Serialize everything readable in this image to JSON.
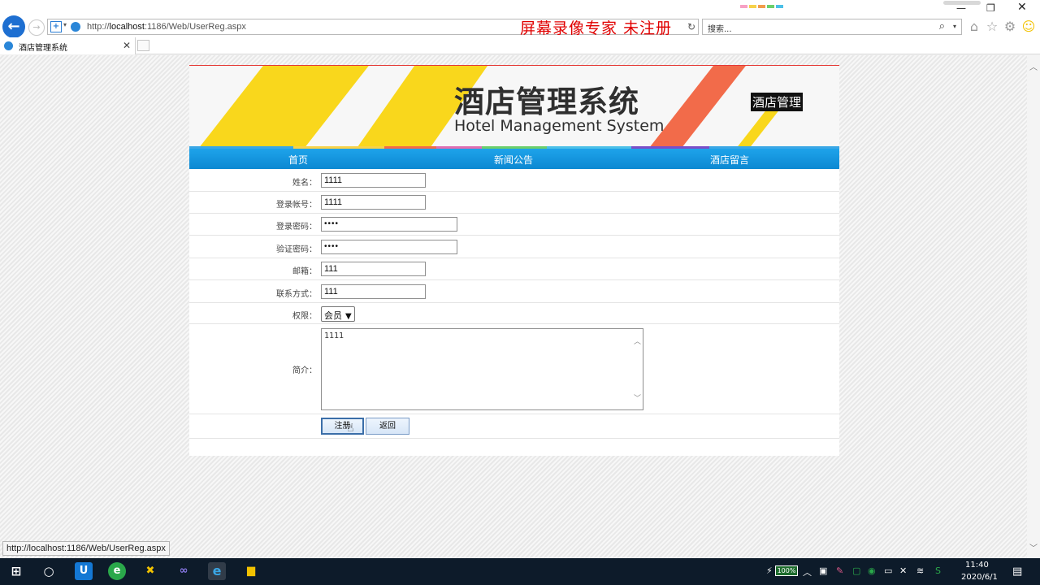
{
  "browser": {
    "url_prefix": "http://",
    "url_host": "localhost",
    "url_rest": ":1186/Web/UserReg.aspx",
    "search_placeholder": "搜索...",
    "tab_title": "酒店管理系统",
    "watermark": "屏幕录像专家  未注册",
    "status_url": "http://localhost:1186/Web/UserReg.aspx"
  },
  "site": {
    "banner_title_cn": "酒店管理系统",
    "banner_title_en": "Hotel Management System",
    "banner_badge": "酒店管理",
    "nav": [
      "首页",
      "新闻公告",
      "酒店留言"
    ]
  },
  "form": {
    "name_label": "姓名：",
    "name_value": "1111",
    "account_label": "登录帐号：",
    "account_value": "1111",
    "password_label": "登录密码：",
    "password_value": "••••",
    "confirm_label": "验证密码：",
    "confirm_value": "••••",
    "email_label": "邮箱：",
    "email_value": "111",
    "contact_label": "联系方式：",
    "contact_value": "111",
    "role_label": "权限：",
    "role_value": "会员",
    "intro_label": "简介：",
    "intro_value": "1111",
    "register_label": "注册",
    "back_label": "返回"
  },
  "taskbar": {
    "battery": "100%",
    "time": "11:40",
    "date": "2020/6/1"
  },
  "colors": {
    "browser_accent": "#1e6fd1",
    "nav_bar": "#1296dc",
    "watermark": "#e00000",
    "banner_yellow": "#f9d71c",
    "banner_orange": "#f26b4a"
  }
}
